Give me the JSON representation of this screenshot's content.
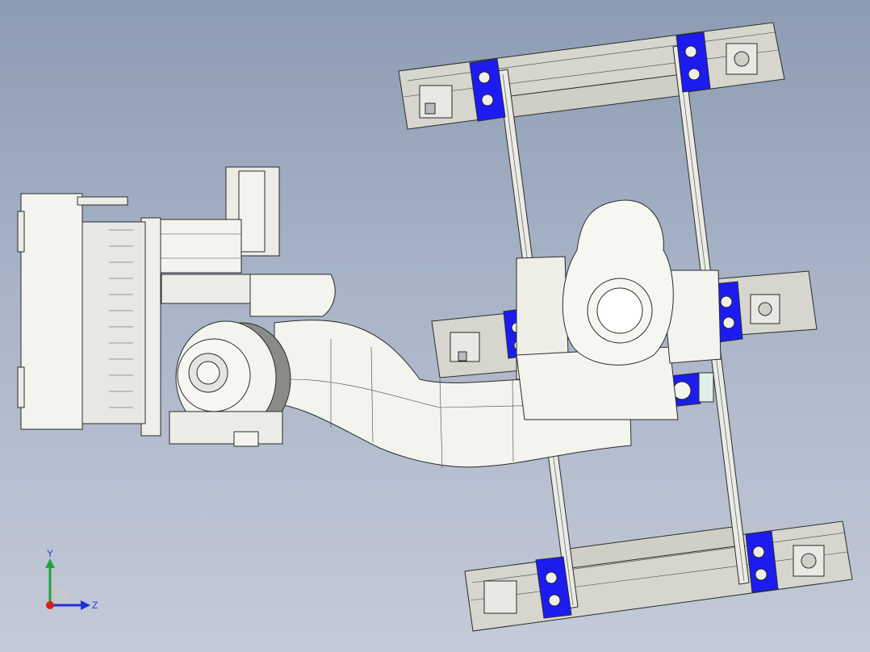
{
  "viewport": {
    "background_top": "#8c9cb3",
    "background_bottom": "#c3cad8"
  },
  "colors": {
    "body": "#f4f4ee",
    "rail": "#d9d9d2",
    "clamp": "#1c1cf0",
    "metal": "#e7e7e1"
  },
  "triad": {
    "y_label": "Y",
    "z_label": "Z",
    "y_color": "#1fa63a",
    "z_color": "#1f2fd6",
    "x_color": "#d61f1f"
  }
}
